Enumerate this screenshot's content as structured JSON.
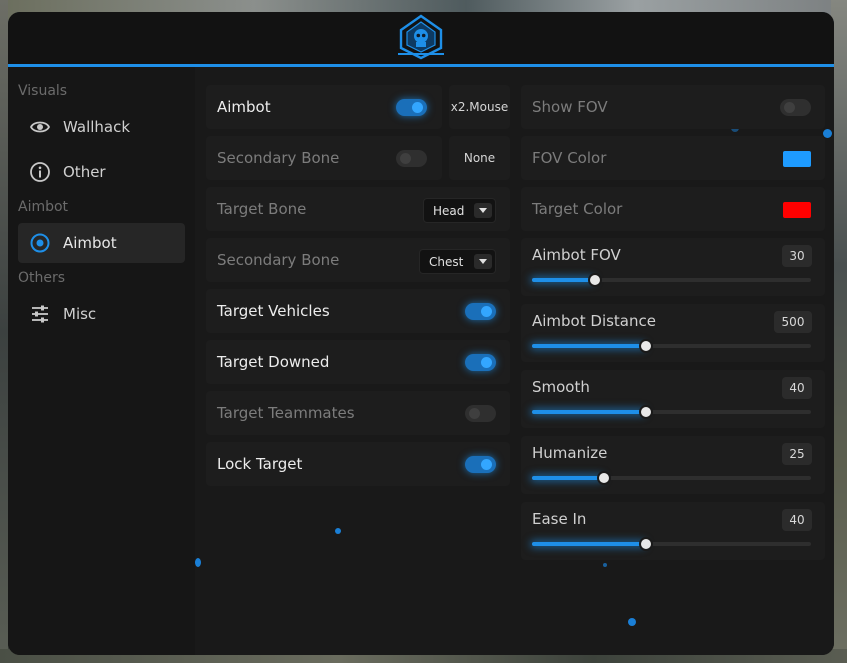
{
  "sidebar": {
    "sections": [
      {
        "label": "Visuals",
        "items": [
          {
            "label": "Wallhack",
            "icon": "eye-icon",
            "active": false
          },
          {
            "label": "Other",
            "icon": "info-icon",
            "active": false
          }
        ]
      },
      {
        "label": "Aimbot",
        "items": [
          {
            "label": "Aimbot",
            "icon": "target-icon",
            "active": true
          }
        ]
      },
      {
        "label": "Others",
        "items": [
          {
            "label": "Misc",
            "icon": "sliders-icon",
            "active": false
          }
        ]
      }
    ]
  },
  "left": {
    "aimbot": {
      "label": "Aimbot",
      "on": true,
      "key": "x2.Mouse"
    },
    "secondary_bone_toggle": {
      "label": "Secondary Bone",
      "on": false,
      "key": "None"
    },
    "target_bone": {
      "label": "Target Bone",
      "value": "Head"
    },
    "secondary_bone": {
      "label": "Secondary Bone",
      "value": "Chest"
    },
    "target_vehicles": {
      "label": "Target Vehicles",
      "on": true
    },
    "target_downed": {
      "label": "Target Downed",
      "on": true
    },
    "target_teammates": {
      "label": "Target Teammates",
      "on": false
    },
    "lock_target": {
      "label": "Lock Target",
      "on": true
    }
  },
  "right": {
    "show_fov": {
      "label": "Show FOV",
      "on": false
    },
    "fov_color": {
      "label": "FOV Color",
      "color": "#1e9bff"
    },
    "target_color": {
      "label": "Target Color",
      "color": "#ff0000"
    },
    "sliders": [
      {
        "label": "Aimbot FOV",
        "value": "30",
        "fraction": 0.22
      },
      {
        "label": "Aimbot Distance",
        "value": "500",
        "fraction": 0.4
      },
      {
        "label": "Smooth",
        "value": "40",
        "fraction": 0.4
      },
      {
        "label": "Humanize",
        "value": "25",
        "fraction": 0.25
      },
      {
        "label": "Ease In",
        "value": "40",
        "fraction": 0.4
      }
    ]
  },
  "colors": {
    "accent": "#1e8fe8"
  }
}
